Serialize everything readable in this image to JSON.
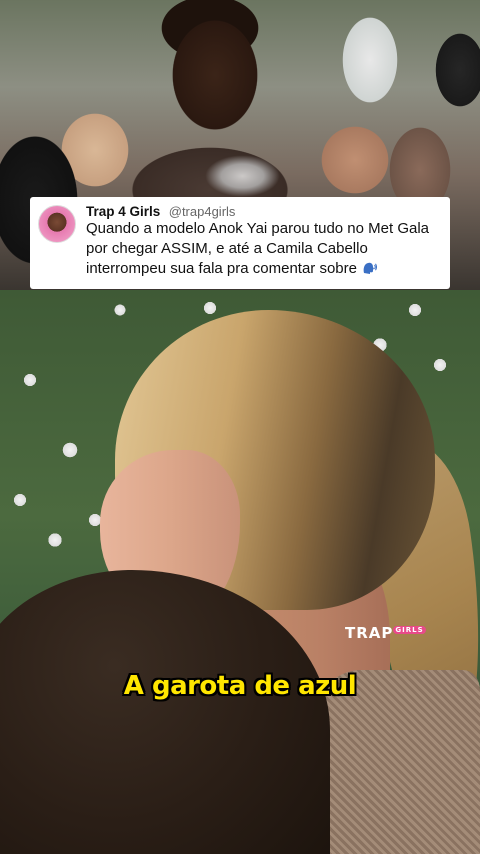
{
  "tweet": {
    "name": "Trap 4 Girls",
    "handle": "@trap4girls",
    "text": "Quando a modelo Anok Yai parou tudo no Met Gala por chegar ASSIM, e até a Camila Cabello interrompeu sua fala pra comentar sobre",
    "emoji_icon": "speaking-head-icon"
  },
  "video": {
    "caption": "A garota de azul",
    "watermark_text": "TRAP",
    "watermark_sub": "GIRLS"
  }
}
